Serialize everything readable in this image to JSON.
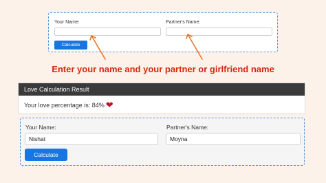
{
  "top_form": {
    "name_label": "Your Name:",
    "partner_label": "Partner's Name:",
    "calculate_label": "Calculate"
  },
  "instruction": "Enter your name and your partner or girlfriend name",
  "result": {
    "header": "Love Calculation Result",
    "percentage_text": "Your love percentage is: 84%",
    "percentage": 84,
    "heart_icon": "heart-icon"
  },
  "bottom_form": {
    "name_label": "Your Name:",
    "name_value": "Nishat",
    "partner_label": "Partner's Name:",
    "partner_value": "Moyna",
    "calculate_label": "Calculate"
  },
  "colors": {
    "accent": "#1976e0",
    "instruction": "#d8260f",
    "arrow": "#e8752c",
    "header_bg": "#3a3a3a",
    "heart": "#c0142a"
  }
}
